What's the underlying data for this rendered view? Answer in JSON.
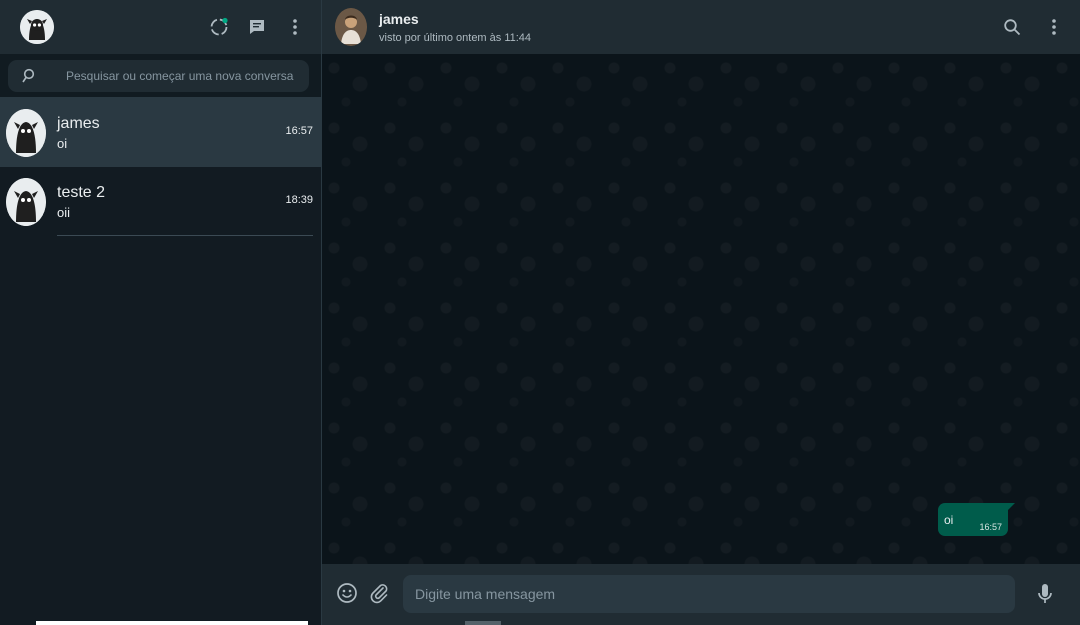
{
  "sidebar": {
    "icons": [
      "status-icon",
      "new-chat-icon",
      "menu-icon"
    ],
    "search": {
      "placeholder": "Pesquisar ou começar uma nova conversa"
    },
    "chats": [
      {
        "name": "james",
        "last_message": "oi",
        "time": "16:57",
        "active": true
      },
      {
        "name": "teste 2",
        "last_message": "oii",
        "time": "18:39",
        "active": false
      }
    ]
  },
  "conversation": {
    "contact_name": "james",
    "contact_status": "visto por último ontem às 11:44",
    "messages": [
      {
        "text": "oi",
        "time": "16:57",
        "outgoing": true
      }
    ],
    "composer": {
      "placeholder": "Digite uma mensagem"
    }
  },
  "colors": {
    "accent": "#00a884",
    "outgoing_bubble": "#005c4b",
    "header_bg": "#202c33",
    "panel_bg": "#111b21"
  }
}
